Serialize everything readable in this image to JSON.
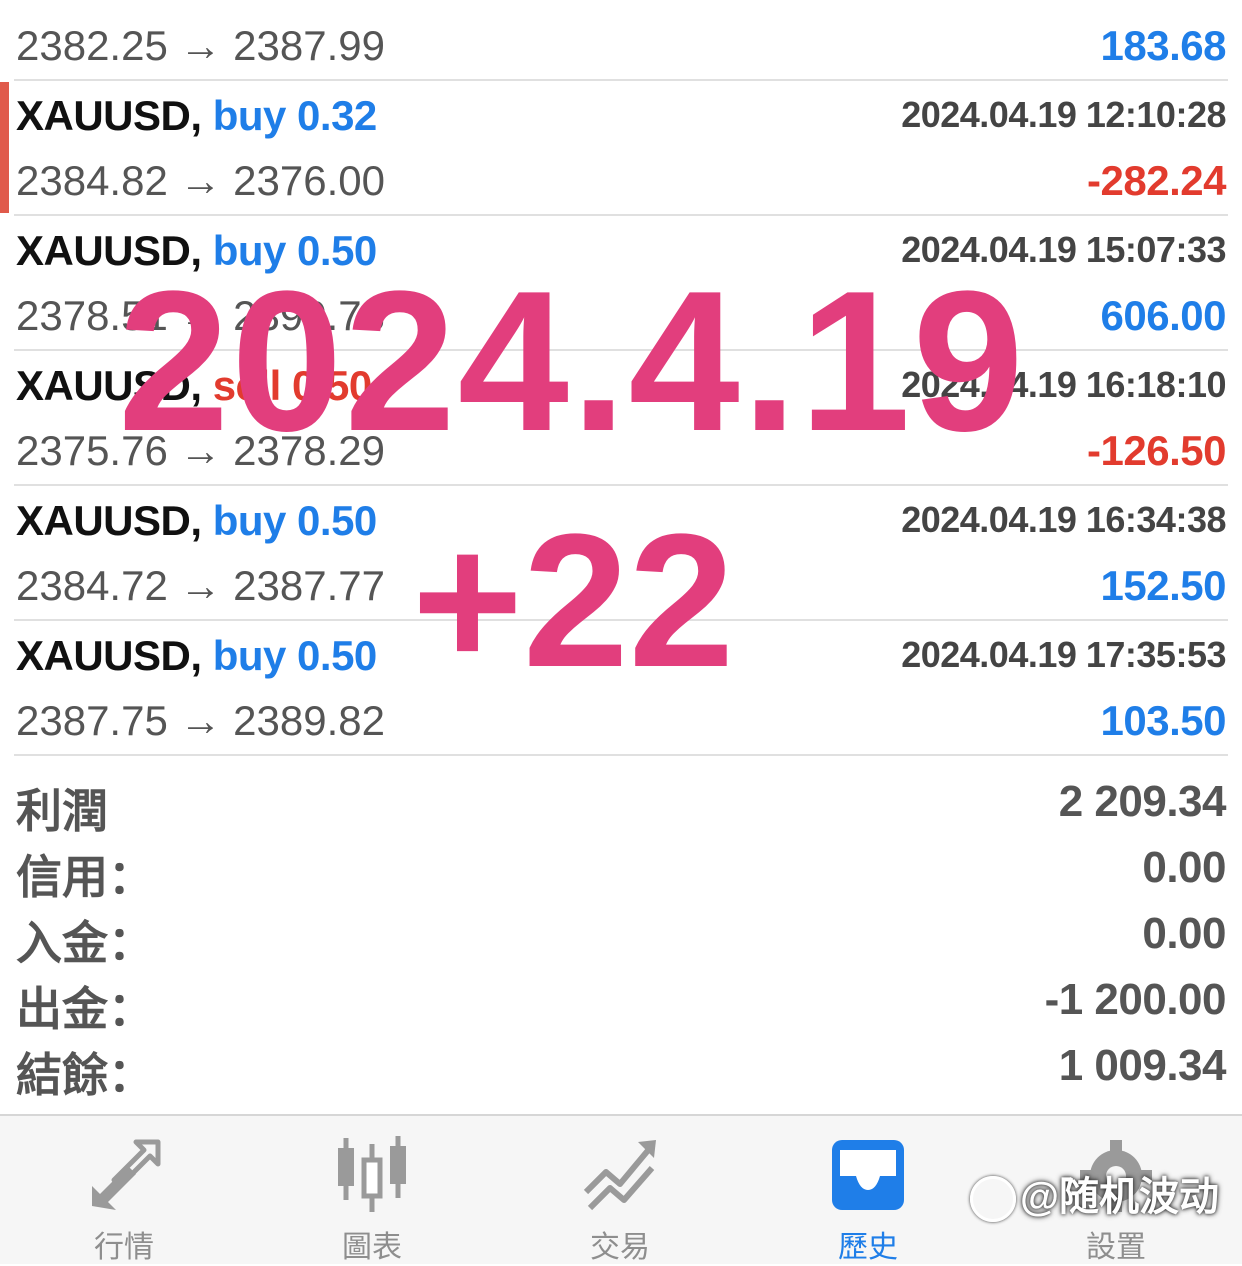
{
  "trades": [
    {
      "symbol": "",
      "side": "",
      "volume": "",
      "time": "",
      "open": "2382.25",
      "close": "2387.99",
      "profit": "183.68",
      "negative": false
    },
    {
      "symbol": "XAUUSD,",
      "side": "buy",
      "volume": "0.32",
      "time": "2024.04.19 12:10:28",
      "open": "2384.82",
      "close": "2376.00",
      "profit": "-282.24",
      "negative": true
    },
    {
      "symbol": "XAUUSD,",
      "side": "buy",
      "volume": "0.50",
      "time": "2024.04.19 15:07:33",
      "open": "2378.51",
      "close": "2390.73",
      "profit": "606.00",
      "negative": false
    },
    {
      "symbol": "XAUUSD,",
      "side": "sell",
      "volume": "0.50",
      "time": "2024.04.19 16:18:10",
      "open": "2375.76",
      "close": "2378.29",
      "profit": "-126.50",
      "negative": true
    },
    {
      "symbol": "XAUUSD,",
      "side": "buy",
      "volume": "0.50",
      "time": "2024.04.19 16:34:38",
      "open": "2384.72",
      "close": "2387.77",
      "profit": "152.50",
      "negative": false
    },
    {
      "symbol": "XAUUSD,",
      "side": "buy",
      "volume": "0.50",
      "time": "2024.04.19 17:35:53",
      "open": "2387.75",
      "close": "2389.82",
      "profit": "103.50",
      "negative": false
    }
  ],
  "arrow": "→",
  "summary": {
    "profit_label": "利潤",
    "profit_value": "2 209.34",
    "credit_label": "信用：",
    "credit_value": "0.00",
    "deposit_label": "入金：",
    "deposit_value": "0.00",
    "withdrawal_label": "出金：",
    "withdrawal_value": "-1 200.00",
    "balance_label": "結餘：",
    "balance_value": "1 009.34"
  },
  "tabs": [
    {
      "label": "行情",
      "icon": "quotes-arrows-icon",
      "active": false
    },
    {
      "label": "圖表",
      "icon": "candlestick-chart-icon",
      "active": false
    },
    {
      "label": "交易",
      "icon": "trade-trend-icon",
      "active": false
    },
    {
      "label": "歷史",
      "icon": "history-inbox-icon",
      "active": true
    },
    {
      "label": "設置",
      "icon": "gear-icon",
      "active": false
    }
  ],
  "overlay": {
    "date": "2024.4.19",
    "gain": "+22"
  },
  "watermark": "@随机波动",
  "colors": {
    "buy": "#1f7ee8",
    "sell": "#e23b2e",
    "overlay": "#e23e7d",
    "active_tab": "#1f7ee8"
  }
}
